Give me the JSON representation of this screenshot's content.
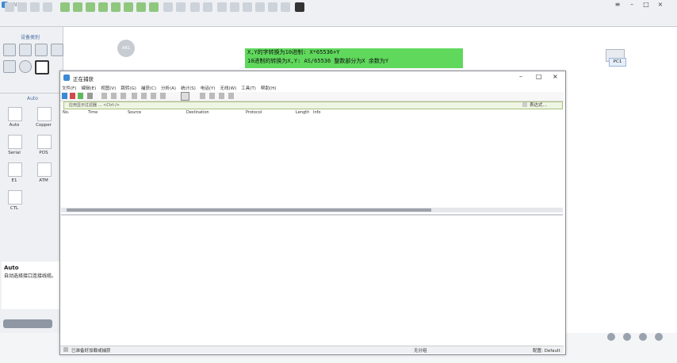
{
  "app": {
    "title": "eNSP"
  },
  "left_panel": {
    "devices_title": "设备类别",
    "cables_title": "Auto",
    "cables": [
      {
        "label": "Auto"
      },
      {
        "label": "Copper"
      },
      {
        "label": "Serial"
      },
      {
        "label": "POS"
      },
      {
        "label": "E1"
      },
      {
        "label": "ATM"
      },
      {
        "label": "CTL"
      }
    ],
    "description": {
      "title": "Auto",
      "text": "自动选择接口连接线缆。"
    }
  },
  "canvas": {
    "note_line1": "X,Y的字转换为10进制: X*65536+Y",
    "note_line2": "10进制的转换为X,Y: AS/65536  整数部分为X  余数为Y",
    "router_label": "AR1",
    "pc_label": "PC1"
  },
  "capture": {
    "title": "正在捕获",
    "menu": [
      "文件(F)",
      "编辑(E)",
      "视图(V)",
      "跳转(G)",
      "捕获(C)",
      "分析(A)",
      "统计(S)",
      "电话(Y)",
      "无线(W)",
      "工具(T)",
      "帮助(H)"
    ],
    "filter_placeholder": "应用显示过滤器 … <Ctrl-/>",
    "filter_right": "表达式…",
    "columns": [
      "No.",
      "Time",
      "Source",
      "Destination",
      "Protocol",
      "Length",
      "Info"
    ],
    "status_left": "已准备好加载或捕获",
    "status_mid": "无分组",
    "status_right": "配置: Default"
  },
  "colors": {
    "note_bg": "#5fd85c",
    "accent": "#3b8ad6"
  }
}
